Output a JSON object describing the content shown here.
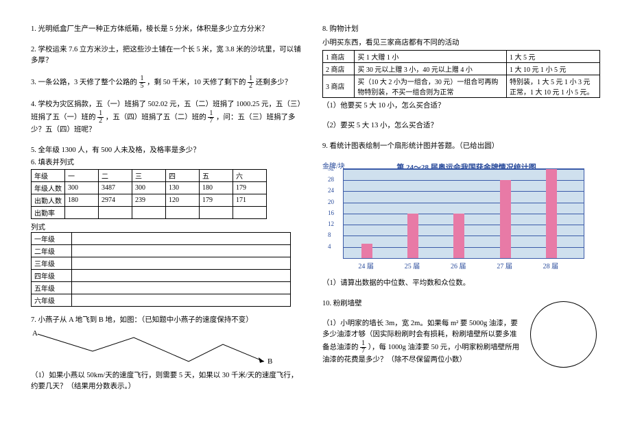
{
  "left": {
    "q1": "1. 光明纸盒厂生产一种正方体纸箱，棱长是 5 分米，体积是多少立方分米？",
    "q2": "2. 学校运来 7.6 立方米沙土，把这些沙土铺在一个长 5 米，宽 3.8 米的沙坑里，可以铺多厚？",
    "q3_a": "3. 一条公路，3 天修了整个公路的",
    "q3_b": "，剩 50 千米，10 天修了剩下的",
    "q3_c": "还剩多少？",
    "q4_a": "4. 学校为灾区捐款，五（一）班捐了 502.02 元，五（二）班捐了 1000.25 元，五（三）班捐了五（一）班的",
    "q4_b": "，五（四）班捐了五（二）班的",
    "q4_c": "，问：五（三）班捐了多少？五（四）班呢？",
    "q5": "5. 全年级 1300 人，有 500 人未及格，及格率是多少？",
    "q6_title": "6. 填表并列式",
    "grade_head": [
      "年级",
      "一",
      "二",
      "三",
      "四",
      "五",
      "六"
    ],
    "row_people": [
      "年级人数",
      "300",
      "3487",
      "300",
      "130",
      "180",
      "179"
    ],
    "row_attend": [
      "出勤人数",
      "180",
      "2974",
      "239",
      "120",
      "179",
      "171"
    ],
    "row_rate": [
      "出勤率",
      "",
      "",
      "",
      "",
      "",
      ""
    ],
    "list_label": "列式",
    "grades": [
      "一年级",
      "二年级",
      "三年级",
      "四年级",
      "五年级",
      "六年级"
    ],
    "q7_title": "7. 小燕子从 A 地飞到 B 地，如图：（已知题中小燕子的速度保持不变）",
    "point_a": "A",
    "point_b": "B",
    "q7_1": "（1）如果小燕以 50km/天的速度飞行，则需要 5 天，如果以 30 千米/天的速度飞行，约要几天？（结果用分数表示。）"
  },
  "right": {
    "q8_title": "8. 购物计划",
    "q8_intro": "小明买东西，看见三家商店都有不同的活动",
    "shop_rows": [
      [
        "1 商店",
        "买 1 大赠 1 小",
        "1 大 5 元"
      ],
      [
        "2 商店",
        "买 30 元以上赠 3 小，40 元以上赠 4 小",
        "1 大 10 元 1 小 5 元"
      ],
      [
        "3 商店",
        "买（10 大 2 小为一组合，30 元）一组合可再购物特别装，不买一组合则为正常",
        "特别装，1 大 5 元 1 小 3 元 正常，1 大 10 元 1 小 5 元。"
      ]
    ],
    "q8_1": "（1）他要买 5 大 10 小，怎么买合适？",
    "q8_2": "（2）要买 5 大 13 小，怎么买合适？",
    "q9_title": "9. 看统计图表绘制一个扇形统计图并答题。（已给出圆）",
    "chart_ylabel": "金牌/块",
    "chart_title": "第 24～28 届奥运会我国获金牌情况统计图",
    "q9_1": "（1）请算出数据的中位数、平均数和众位数。",
    "q10_title": "10. 粉刷墙壁",
    "q10_a": "（1）小明家的墙长 3m，宽 2m。如果每 m² 要 5000g 油漆，要多少油漆才够（因实际粉刷时会有损耗，粉刷墙壁所以要多准备总油漆的",
    "q10_b": "），每 1000g 油漆要 50 元，小明家粉刷墙壁所用油漆的花费是多少？（除不尽保留两位小数）"
  },
  "fracs": {
    "f15": {
      "n": "1",
      "d": "5"
    },
    "f12": {
      "n": "1",
      "d": "2"
    },
    "f17": {
      "n": "1",
      "d": "7"
    }
  },
  "chart_data": {
    "type": "bar",
    "categories": [
      "24 届",
      "25 届",
      "26 届",
      "27 届",
      "28 届"
    ],
    "values": [
      5,
      16,
      16,
      28,
      32
    ],
    "title": "第 24～28 届奥运会我国获金牌情况统计图",
    "xlabel": "",
    "ylabel": "金牌/块",
    "ylim": [
      0,
      32
    ],
    "yticks": [
      4,
      8,
      12,
      16,
      20,
      24,
      28,
      32
    ]
  }
}
